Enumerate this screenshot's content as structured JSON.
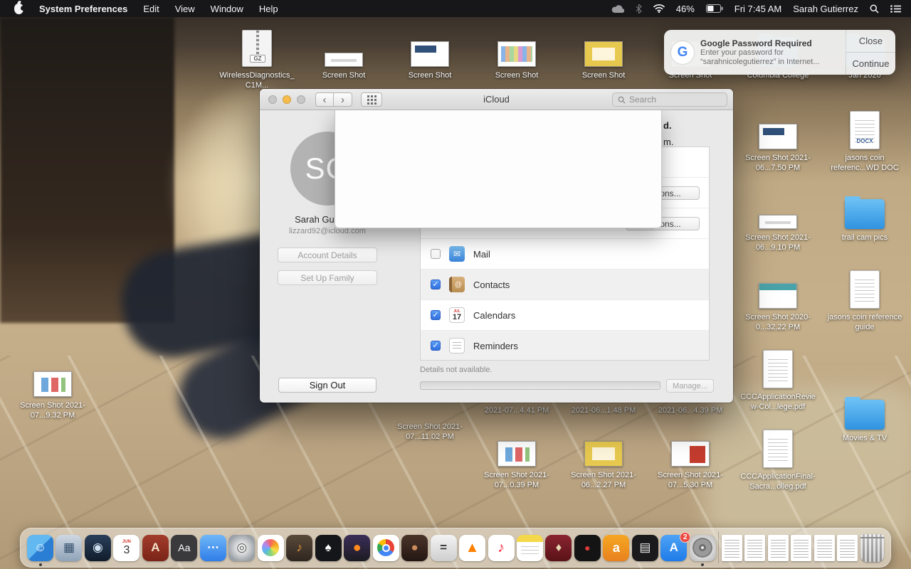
{
  "menu_bar": {
    "app_name": "System Preferences",
    "menus": [
      "Edit",
      "View",
      "Window",
      "Help"
    ],
    "battery": "46%",
    "clock": "Fri 7:45 AM",
    "user": "Sarah Gutierrez"
  },
  "notification": {
    "title": "Google Password Required",
    "body_line1": "Enter your password for",
    "body_line2": "“sarahnicolegutierrez” in Internet...",
    "close_label": "Close",
    "continue_label": "Continue"
  },
  "window": {
    "title": "iCloud",
    "search_placeholder": "Search",
    "sidebar": {
      "initials": "SG",
      "name": "Sarah Gutierrez",
      "email": "lizzard92@icloud.com",
      "account_details": "Account Details",
      "set_up_family": "Set Up Family",
      "sign_out": "Sign Out"
    },
    "fragments": {
      "line1": "d.",
      "line2": "m."
    },
    "options_button": "Options...",
    "services": [
      {
        "label": "Mail",
        "checked": false
      },
      {
        "label": "Contacts",
        "checked": true
      },
      {
        "label": "Calendars",
        "checked": true
      },
      {
        "label": "Reminders",
        "checked": true
      }
    ],
    "check_glyph": "✓",
    "details_text": "Details not available.",
    "manage_label": "Manage..."
  },
  "desktop_icons": [
    {
      "label": "WirelessDiagnostics_C1M...",
      "type": "gz-archive",
      "tag": "GZ"
    },
    {
      "label": "Screen Shot",
      "type": "screenshot"
    },
    {
      "label": "Screen Shot",
      "type": "screenshot"
    },
    {
      "label": "Screen Shot",
      "type": "screenshot"
    },
    {
      "label": "Screen Shot",
      "type": "screenshot"
    },
    {
      "label": "Screen Shot",
      "type": "screenshot"
    },
    {
      "label": "Columbia College",
      "type": "folder"
    },
    {
      "label": "Jan 2020",
      "type": "folder"
    },
    {
      "label": "Screen Shot 2021-06...7.50 PM",
      "type": "screenshot"
    },
    {
      "label": "jasons coin referenc...WD DOC",
      "type": "docx",
      "tag": "DOCX"
    },
    {
      "label": "Screen Shot 2021-06...9.10 PM",
      "type": "screenshot"
    },
    {
      "label": "trail cam pics",
      "type": "folder"
    },
    {
      "label": "Screen Shot 2020-0...32.22 PM",
      "type": "screenshot"
    },
    {
      "label": "jasons coin reference guide",
      "type": "document"
    },
    {
      "label": "CCCApplicationReview-Col...lege.pdf",
      "type": "pdf"
    },
    {
      "label": "Movies & TV",
      "type": "folder"
    },
    {
      "label": "CCCApplicationFinal-Sacra...olleg.pdf",
      "type": "pdf"
    },
    {
      "label": "Screen Shot 2021-07...9.32 PM",
      "type": "screenshot"
    },
    {
      "label": "Screen Shot 2021-07...11.02 PM",
      "type": "screenshot"
    },
    {
      "label": "2021-07...4.41 PM",
      "type": "screenshot-partial"
    },
    {
      "label": "2021-06...1.48 PM",
      "type": "screenshot-partial"
    },
    {
      "label": "2021-06...4.39 PM",
      "type": "screenshot-partial"
    },
    {
      "label": "Screen Shot 2021-07...0.39 PM",
      "type": "screenshot"
    },
    {
      "label": "Screen Shot 2021-06...2.27 PM",
      "type": "screenshot"
    },
    {
      "label": "Screen Shot 2021-07...5.30 PM",
      "type": "screenshot"
    }
  ],
  "dock": {
    "apps": [
      {
        "name": "finder",
        "glyph": "☺"
      },
      {
        "name": "preview",
        "glyph": "▦"
      },
      {
        "name": "steam",
        "glyph": "◉"
      },
      {
        "name": "calendar",
        "month": "JUN",
        "day": "3"
      },
      {
        "name": "dictionary",
        "glyph": "A"
      },
      {
        "name": "textedit",
        "glyph": "Aa"
      },
      {
        "name": "messages",
        "glyph": "⋯"
      },
      {
        "name": "dvd-player",
        "glyph": "◎"
      },
      {
        "name": "photos"
      },
      {
        "name": "garageband",
        "glyph": "♪"
      },
      {
        "name": "solitaire",
        "glyph": "♠"
      },
      {
        "name": "firefox",
        "glyph": "●"
      },
      {
        "name": "chrome"
      },
      {
        "name": "coffee",
        "glyph": "●"
      },
      {
        "name": "calculator",
        "glyph": "="
      },
      {
        "name": "vlc",
        "glyph": "▲"
      },
      {
        "name": "music",
        "glyph": "♪"
      },
      {
        "name": "notes"
      },
      {
        "name": "boardgame",
        "glyph": "♦"
      },
      {
        "name": "bowling",
        "glyph": "●"
      },
      {
        "name": "amazon",
        "glyph": "a"
      },
      {
        "name": "books",
        "glyph": "▤"
      },
      {
        "name": "app-store",
        "glyph": "A",
        "badge": "2"
      },
      {
        "name": "system-preferences"
      }
    ],
    "document_count": 6
  }
}
